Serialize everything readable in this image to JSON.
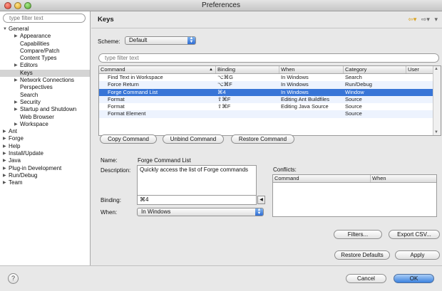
{
  "window": {
    "title": "Preferences"
  },
  "sidebar": {
    "filter_placeholder": "type filter text",
    "items": [
      {
        "label": "General",
        "level": 0,
        "arrow": "down"
      },
      {
        "label": "Appearance",
        "level": 1,
        "arrow": "right"
      },
      {
        "label": "Capabilities",
        "level": 1,
        "arrow": ""
      },
      {
        "label": "Compare/Patch",
        "level": 1,
        "arrow": ""
      },
      {
        "label": "Content Types",
        "level": 1,
        "arrow": ""
      },
      {
        "label": "Editors",
        "level": 1,
        "arrow": "right"
      },
      {
        "label": "Keys",
        "level": 1,
        "arrow": "",
        "selected": true
      },
      {
        "label": "Network Connections",
        "level": 1,
        "arrow": "right"
      },
      {
        "label": "Perspectives",
        "level": 1,
        "arrow": ""
      },
      {
        "label": "Search",
        "level": 1,
        "arrow": ""
      },
      {
        "label": "Security",
        "level": 1,
        "arrow": "right"
      },
      {
        "label": "Startup and Shutdown",
        "level": 1,
        "arrow": "right"
      },
      {
        "label": "Web Browser",
        "level": 1,
        "arrow": ""
      },
      {
        "label": "Workspace",
        "level": 1,
        "arrow": "right"
      },
      {
        "label": "Ant",
        "level": 0,
        "arrow": "right"
      },
      {
        "label": "Forge",
        "level": 0,
        "arrow": "right"
      },
      {
        "label": "Help",
        "level": 0,
        "arrow": "right"
      },
      {
        "label": "Install/Update",
        "level": 0,
        "arrow": "right"
      },
      {
        "label": "Java",
        "level": 0,
        "arrow": "right"
      },
      {
        "label": "Plug-in Development",
        "level": 0,
        "arrow": "right"
      },
      {
        "label": "Run/Debug",
        "level": 0,
        "arrow": "right"
      },
      {
        "label": "Team",
        "level": 0,
        "arrow": "right"
      }
    ]
  },
  "main": {
    "title": "Keys",
    "scheme_label": "Scheme:",
    "scheme_value": "Default",
    "filter_placeholder": "type filter text",
    "columns": [
      "Command",
      "Binding",
      "When",
      "Category",
      "User"
    ],
    "rows": [
      {
        "command": "Find Text in Workspace",
        "binding": "⌥⌘G",
        "when": "In Windows",
        "category": "Search",
        "user": ""
      },
      {
        "command": "Force Return",
        "binding": "⌥⌘F",
        "when": "In Windows",
        "category": "Run/Debug",
        "user": ""
      },
      {
        "command": "Forge Command List",
        "binding": "⌘4",
        "when": "In Windows",
        "category": "Window",
        "user": "",
        "selected": true
      },
      {
        "command": "Format",
        "binding": "⇧⌘F",
        "when": "Editing Ant Buildfiles",
        "category": "Source",
        "user": ""
      },
      {
        "command": "Format",
        "binding": "⇧⌘F",
        "when": "Editing Java Source",
        "category": "Source",
        "user": ""
      },
      {
        "command": "Format Element",
        "binding": "",
        "when": "",
        "category": "Source",
        "user": ""
      }
    ],
    "buttons": {
      "copy": "Copy Command",
      "unbind": "Unbind Command",
      "restore": "Restore Command"
    },
    "details": {
      "name_label": "Name:",
      "name_value": "Forge Command List",
      "description_label": "Description:",
      "description_value": "Quickly access the list of Forge commands",
      "binding_label": "Binding:",
      "binding_value": "⌘4",
      "when_label": "When:",
      "when_value": "In Windows"
    },
    "conflicts": {
      "label": "Conflicts:",
      "columns": [
        "Command",
        "When"
      ]
    },
    "filters_button": "Filters...",
    "export_button": "Export CSV...",
    "restore_defaults_button": "Restore Defaults",
    "apply_button": "Apply"
  },
  "footer": {
    "help_glyph": "?",
    "cancel_button": "Cancel",
    "ok_button": "OK"
  },
  "colors": {
    "selection": "#3875d7",
    "accent_button": "#3c82df"
  }
}
